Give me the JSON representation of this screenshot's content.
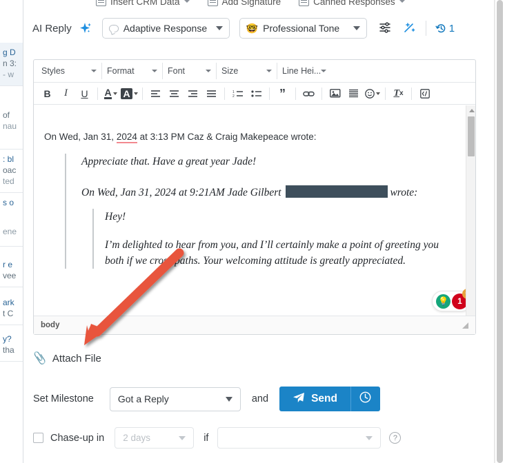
{
  "top_toolbar": {
    "items": [
      {
        "label": "Insert CRM Data",
        "icon": "crm-data-icon",
        "caret": true
      },
      {
        "label": "Add Signature",
        "icon": "signature-icon",
        "caret": false
      },
      {
        "label": "Canned Responses",
        "icon": "canned-responses-icon",
        "caret": true
      }
    ]
  },
  "ai_row": {
    "label": "AI Reply",
    "sparkle_icon": "sparkle-icon",
    "response_mode": {
      "value": "Adaptive Response",
      "icon": "speech-bubble-icon"
    },
    "tone": {
      "value": "Professional Tone",
      "icon": "nerd-face-emoji",
      "emoji": "🤓"
    },
    "settings_icon": "sliders-icon",
    "magic_icon": "magic-wand-icon",
    "history_icon": "history-icon",
    "history_count": "1"
  },
  "editor": {
    "dropdowns": [
      {
        "label": "Styles"
      },
      {
        "label": "Format"
      },
      {
        "label": "Font"
      },
      {
        "label": "Size"
      },
      {
        "label": "Line Hei..."
      }
    ],
    "toolbar_buttons": [
      {
        "name": "bold-button",
        "glyph": "B"
      },
      {
        "name": "italic-button",
        "glyph": "I"
      },
      {
        "name": "underline-button",
        "glyph": "U"
      },
      {
        "name": "text-color-button",
        "glyph": "A"
      },
      {
        "name": "background-color-button",
        "glyph": "A"
      },
      {
        "name": "align-left-button",
        "glyph": "≡"
      },
      {
        "name": "align-center-button",
        "glyph": "≡"
      },
      {
        "name": "align-right-button",
        "glyph": "≡"
      },
      {
        "name": "justify-button",
        "glyph": "≡"
      },
      {
        "name": "numbered-list-button",
        "glyph": "1≡"
      },
      {
        "name": "bullet-list-button",
        "glyph": "☰"
      },
      {
        "name": "blockquote-button",
        "glyph": "”"
      },
      {
        "name": "insert-link-button",
        "glyph": "⚭"
      },
      {
        "name": "insert-image-button",
        "glyph": "Ὓc"
      },
      {
        "name": "horizontal-rule-button",
        "glyph": "≡"
      },
      {
        "name": "emoji-button",
        "glyph": "☺"
      },
      {
        "name": "remove-format-button",
        "glyph": "Tx"
      },
      {
        "name": "source-code-button",
        "glyph": "‹›"
      }
    ],
    "body": {
      "intro_before": "On Wed, Jan 31, ",
      "intro_year": "2024",
      "intro_after": " at 3:13 PM Caz & Craig Makepeace wrote:",
      "quote1_line1": "Appreciate that. Have a great year Jade!",
      "quote1_line2_before": "On Wed, Jan 31, 2024 at 9:21AM Jade Gilbert ",
      "quote1_line2_after": "wrote:",
      "quote2_greeting": "Hey!",
      "quote2_paragraph": "I’m delighted to hear from you, and I’ll certainly make a point of greeting you both if we cross paths. Your welcoming attitude is greatly appreciated."
    },
    "grammarly": {
      "count": "1",
      "plus": "+",
      "bulb_icon": "lightbulb-icon"
    },
    "status_path": "body"
  },
  "attach": {
    "label": "Attach File",
    "icon": "paperclip-icon"
  },
  "milestone": {
    "label": "Set Milestone",
    "value": "Got a Reply",
    "and_label": "and",
    "send_label": "Send",
    "send_icon": "paper-plane-icon",
    "schedule_icon": "clock-icon"
  },
  "chase": {
    "label": "Chase-up in",
    "checked": false,
    "days_placeholder": "2 days",
    "if_label": "if",
    "condition_placeholder": "",
    "help_icon": "question-mark-icon"
  },
  "left_panel": {
    "rows": [
      {
        "l1": "g D",
        "l2": "n 3:",
        "l3": "- w",
        "selected": true
      },
      {
        "l1": "",
        "l2": " of",
        "l3": "nau",
        "selected": false
      },
      {
        "l1": ": bl",
        "l2": "oac",
        "l3": "ted",
        "selected": false
      },
      {
        "l1": "s o",
        "l2": "",
        "l3": "ene",
        "selected": false
      },
      {
        "l1": "r e",
        "l2": "vee",
        "l3": "",
        "selected": false
      },
      {
        "l1": "ark",
        "l2": "t C",
        "l3": "",
        "selected": false
      },
      {
        "l1": "y?",
        "l2": "tha",
        "l3": "",
        "selected": false
      }
    ]
  },
  "colors": {
    "accent_blue": "#1b84c7",
    "link_blue": "#1278bd",
    "annotation_red": "#e8553e",
    "redaction": "#3e4f5c",
    "spellcheck_underline": "#f2898f",
    "badge_red": "#d0021b",
    "bulb_green": "#15a67a",
    "plus_orange": "#e8a33d"
  }
}
